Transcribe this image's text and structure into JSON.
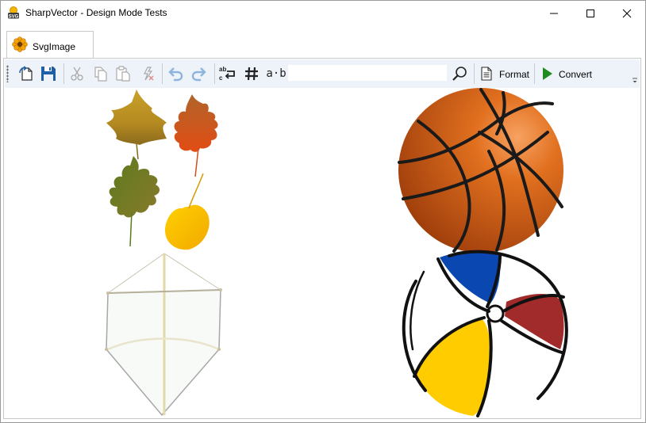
{
  "window": {
    "title": "SharpVector - Design Mode Tests",
    "app_icon": "svg-badge-icon",
    "controls": [
      "minimize-icon",
      "maximize-icon",
      "close-icon"
    ]
  },
  "tabs": [
    {
      "label": "SvgImage",
      "icon": "flower-icon",
      "selected": true
    }
  ],
  "toolbar": {
    "buttons": [
      "open-file-icon",
      "save-icon",
      "cut-icon",
      "copy-icon",
      "paste-icon",
      "clear-icon",
      "undo-icon",
      "redo-icon",
      "replace-icon",
      "hash-icon",
      "whole-word-icon",
      "search-icon"
    ],
    "find_value": "",
    "whole_word_label": "a·b",
    "format_label": "Format",
    "convert_label": "Convert"
  },
  "canvas": {
    "images": [
      "autumn-leaves",
      "kite",
      "basketball",
      "beach-ball"
    ]
  },
  "colors": {
    "toolbar_bg": "#eef3fa",
    "accent_blue": "#1e5fa8",
    "convert_green": "#1f8a1f"
  }
}
